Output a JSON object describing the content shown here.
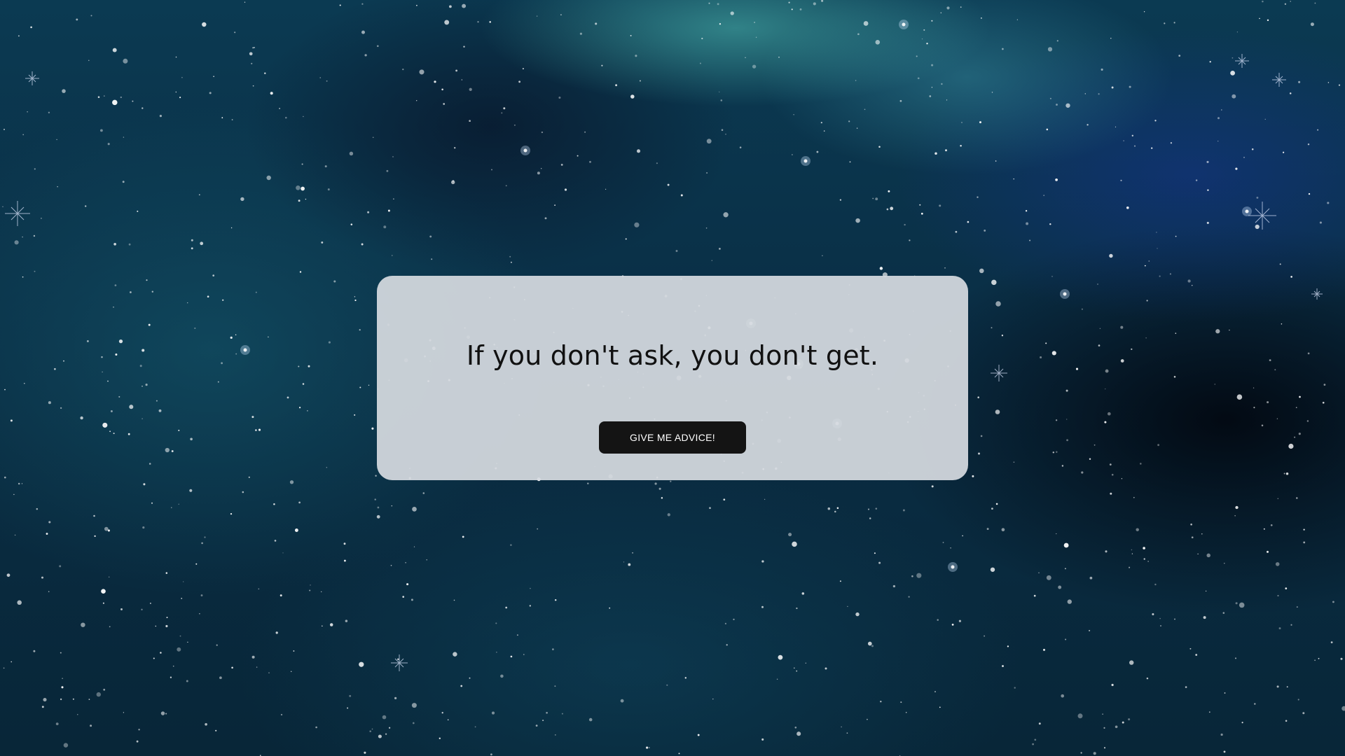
{
  "advice": {
    "text": "If you don't ask, you don't get."
  },
  "button": {
    "label": "GIVE ME ADVICE!"
  },
  "colors": {
    "card_background": "#d6dae0",
    "button_background": "#141414",
    "button_text": "#ffffff",
    "text": "#111111"
  }
}
